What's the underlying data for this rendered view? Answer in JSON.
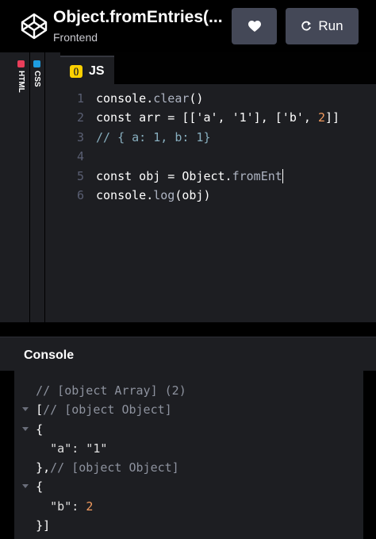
{
  "header": {
    "title": "Object.fromEntries(...",
    "subtitle": "Frontend",
    "run_label": "Run"
  },
  "side_tabs": [
    {
      "label": "HTML",
      "color": "#e83e5a"
    },
    {
      "label": "CSS",
      "color": "#1e9de1"
    }
  ],
  "js_tab": {
    "badge": "()",
    "label": "JS"
  },
  "code": [
    {
      "n": "1",
      "tokens": [
        {
          "t": "console.",
          "c": "ct"
        },
        {
          "t": "clear",
          "c": "fn"
        },
        {
          "t": "()",
          "c": "ct"
        }
      ]
    },
    {
      "n": "2",
      "tokens": [
        {
          "t": "const arr = [['a', '1'], ['b', ",
          "c": "ct"
        },
        {
          "t": "2",
          "c": "num"
        },
        {
          "t": "]]",
          "c": "ct"
        }
      ]
    },
    {
      "n": "3",
      "tokens": [
        {
          "t": "// { a: 1, b: 1}",
          "c": "cm"
        }
      ]
    },
    {
      "n": "4",
      "tokens": []
    },
    {
      "n": "5",
      "tokens": [
        {
          "t": "const obj = Object.",
          "c": "ct"
        },
        {
          "t": "fromEnt",
          "c": "fn"
        }
      ],
      "cursor": true
    },
    {
      "n": "6",
      "tokens": [
        {
          "t": "console.",
          "c": "ct"
        },
        {
          "t": "log",
          "c": "fn"
        },
        {
          "t": "(obj)",
          "c": "ct"
        }
      ]
    }
  ],
  "console": {
    "title": "Console",
    "lines": [
      {
        "indent": "  ",
        "toggle": false,
        "tokens": [
          {
            "t": "// [object Array] (2)",
            "c": "cgray"
          }
        ]
      },
      {
        "indent": "  ",
        "toggle": true,
        "tokens": [
          {
            "t": "[",
            "c": "cwhite"
          },
          {
            "t": "// [object Object]",
            "c": "cgray"
          }
        ]
      },
      {
        "indent": "  ",
        "toggle": true,
        "tokens": [
          {
            "t": "{",
            "c": "cwhite"
          }
        ]
      },
      {
        "indent": "    ",
        "toggle": false,
        "tokens": [
          {
            "t": "\"a\": \"1\"",
            "c": "cstr"
          }
        ]
      },
      {
        "indent": "  ",
        "toggle": false,
        "tokens": [
          {
            "t": "},",
            "c": "cwhite"
          },
          {
            "t": "// [object Object]",
            "c": "cgray"
          }
        ]
      },
      {
        "indent": "  ",
        "toggle": true,
        "tokens": [
          {
            "t": "{",
            "c": "cwhite"
          }
        ]
      },
      {
        "indent": "    ",
        "toggle": false,
        "tokens": [
          {
            "t": "\"b\": ",
            "c": "cstr"
          },
          {
            "t": "2",
            "c": "corange"
          }
        ]
      },
      {
        "indent": "  ",
        "toggle": false,
        "tokens": [
          {
            "t": "}]",
            "c": "cwhite"
          }
        ]
      }
    ]
  },
  "icons": {
    "logo": "codepen-logo-icon",
    "edit": "pencil-icon",
    "heart": "heart-icon",
    "run": "refresh-icon"
  }
}
